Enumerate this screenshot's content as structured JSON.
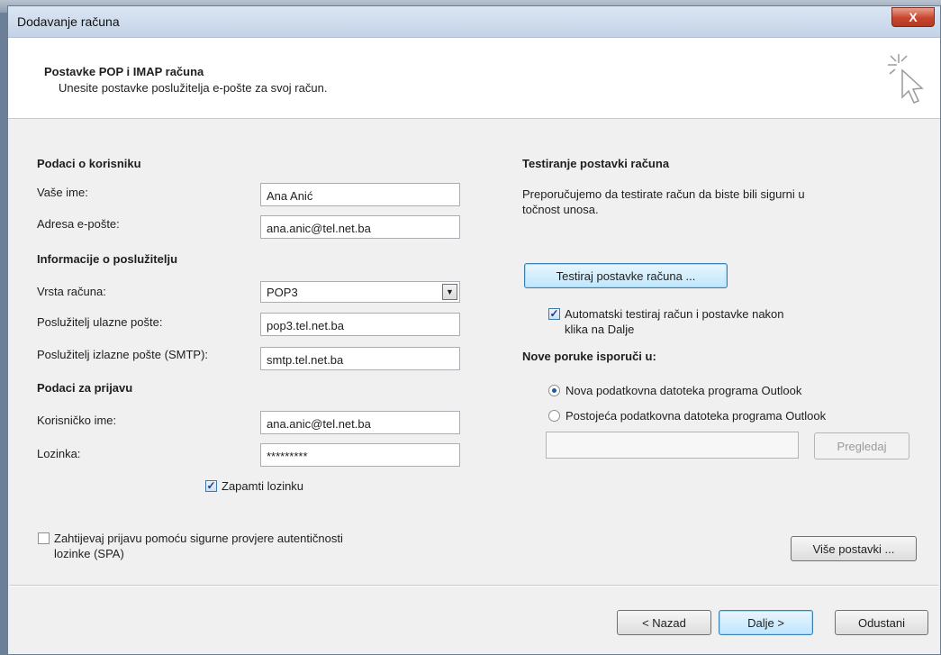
{
  "window": {
    "title": "Dodavanje računa",
    "close_label": "X"
  },
  "header": {
    "title": "Postavke POP i IMAP računa",
    "subtitle": "Unesite postavke poslužitelja e-pošte za svoj račun."
  },
  "user_info": {
    "heading": "Podaci o korisniku",
    "name_label": "Vaše ime:",
    "name_value": "Ana Anić",
    "email_label": "Adresa e-pošte:",
    "email_value": "ana.anic@tel.net.ba"
  },
  "server_info": {
    "heading": "Informacije o poslužitelju",
    "type_label": "Vrsta računa:",
    "type_value": "POP3",
    "incoming_label": "Poslužitelj ulazne pošte:",
    "incoming_value": "pop3.tel.net.ba",
    "outgoing_label": "Poslužitelj izlazne pošte (SMTP):",
    "outgoing_value": "smtp.tel.net.ba"
  },
  "login": {
    "heading": "Podaci za prijavu",
    "username_label": "Korisničko ime:",
    "username_value": "ana.anic@tel.net.ba",
    "password_label": "Lozinka:",
    "password_value": "*********",
    "remember_label": "Zapamti lozinku",
    "remember_checked": true,
    "spa_label_line1": "Zahtijevaj prijavu pomoću sigurne provjere autentičnosti",
    "spa_label_line2": "lozinke (SPA)",
    "spa_checked": false
  },
  "test": {
    "heading": "Testiranje postavki računa",
    "desc_line1": "Preporučujemo da testirate račun da biste bili sigurni u",
    "desc_line2": "točnost unosa.",
    "test_button": "Testiraj postavke računa ...",
    "auto_label_line1": "Automatski testiraj račun i postavke nakon",
    "auto_label_line2": "klika na Dalje",
    "auto_checked": true
  },
  "deliver": {
    "heading": "Nove poruke isporuči u:",
    "option_new": "Nova podatkovna datoteka programa Outlook",
    "option_existing": "Postojeća podatkovna datoteka programa Outlook",
    "selected": "new",
    "browse_button": "Pregledaj"
  },
  "more_button": "Više postavki ...",
  "footer": {
    "back": "< Nazad",
    "next": "Dalje >",
    "cancel": "Odustani"
  }
}
